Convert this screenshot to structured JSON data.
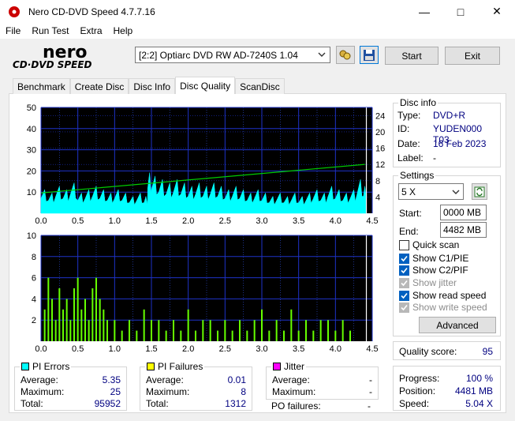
{
  "window": {
    "title": "Nero CD-DVD Speed 4.7.7.16"
  },
  "menu": [
    "File",
    "Run Test",
    "Extra",
    "Help"
  ],
  "toolbar": {
    "drive": "[2:2]   Optiarc DVD RW AD-7240S 1.04",
    "start_label": "Start",
    "exit_label": "Exit"
  },
  "tabs": [
    "Benchmark",
    "Create Disc",
    "Disc Info",
    "Disc Quality",
    "ScanDisc"
  ],
  "active_tab": "Disc Quality",
  "disc_info": {
    "title": "Disc info",
    "type_label": "Type:",
    "type": "DVD+R",
    "id_label": "ID:",
    "id": "YUDEN000 T03",
    "date_label": "Date:",
    "date": "16 Feb 2023",
    "label_label": "Label:",
    "label": "-"
  },
  "settings": {
    "title": "Settings",
    "speed": "5 X",
    "start_label": "Start:",
    "start": "0000 MB",
    "end_label": "End:",
    "end": "4482 MB",
    "quick_scan": "Quick scan",
    "show_c1pie": "Show C1/PIE",
    "show_c2pif": "Show C2/PIF",
    "show_jitter": "Show jitter",
    "show_read_speed": "Show read speed",
    "show_write_speed": "Show write speed",
    "advanced_label": "Advanced"
  },
  "quality": {
    "label": "Quality score:",
    "value": "95"
  },
  "progress": {
    "progress_label": "Progress:",
    "progress": "100 %",
    "position_label": "Position:",
    "position": "4481 MB",
    "speed_label": "Speed:",
    "speed": "5.04 X"
  },
  "pi_errors": {
    "title": "PI Errors",
    "color": "#00ffff",
    "average_label": "Average:",
    "average": "5.35",
    "maximum_label": "Maximum:",
    "maximum": "25",
    "total_label": "Total:",
    "total": "95952"
  },
  "pi_failures": {
    "title": "PI Failures",
    "color": "#ffff00",
    "average_label": "Average:",
    "average": "0.01",
    "maximum_label": "Maximum:",
    "maximum": "8",
    "total_label": "Total:",
    "total": "1312"
  },
  "jitter": {
    "title": "Jitter",
    "color": "#ff00ff",
    "average_label": "Average:",
    "average": "-",
    "maximum_label": "Maximum:",
    "maximum": "-",
    "po_failures_label": "PO failures:",
    "po_failures": "-"
  },
  "chart_data": [
    {
      "type": "area",
      "series": [
        {
          "name": "PI Errors",
          "color": "#00ffff",
          "x": [
            0.0,
            0.1,
            0.2,
            0.3,
            0.4,
            0.5,
            0.6,
            0.7,
            0.8,
            0.9,
            1.0,
            1.1,
            1.2,
            1.3,
            1.4,
            1.45,
            1.5,
            1.6,
            1.7,
            1.8,
            1.9,
            2.0,
            2.1,
            2.2,
            2.3,
            2.4,
            2.5,
            2.6,
            2.7,
            2.8,
            2.9,
            3.0,
            3.1,
            3.2,
            3.3,
            3.4,
            3.5,
            3.6,
            3.7,
            3.8,
            3.9,
            4.0,
            4.1,
            4.2,
            4.3,
            4.38,
            4.42
          ],
          "y": [
            7,
            6,
            8,
            7,
            9,
            6,
            7,
            8,
            7,
            6,
            7,
            6,
            5,
            6,
            5,
            12,
            11,
            10,
            9,
            10,
            9,
            8,
            9,
            8,
            9,
            8,
            7,
            8,
            7,
            6,
            7,
            6,
            5,
            6,
            5,
            6,
            5,
            6,
            7,
            6,
            8,
            7,
            6,
            7,
            10,
            8,
            9
          ]
        },
        {
          "name": "Read speed",
          "color": "#00cc00",
          "x": [
            0.0,
            4.4
          ],
          "y": [
            5,
            12
          ]
        }
      ],
      "xlim": [
        0,
        4.5
      ],
      "ylim": [
        0,
        50
      ],
      "y_ticks": [
        10,
        20,
        30,
        40,
        50
      ],
      "y2_ticks": [
        4,
        8,
        12,
        16,
        20,
        24
      ],
      "x_ticks": [
        "0.0",
        "0.5",
        "1.0",
        "1.5",
        "2.0",
        "2.5",
        "3.0",
        "3.5",
        "4.0",
        "4.5"
      ]
    },
    {
      "type": "bar",
      "series": [
        {
          "name": "PI Failures",
          "color": "#66ff00",
          "x": [
            0.05,
            0.1,
            0.15,
            0.2,
            0.25,
            0.3,
            0.35,
            0.4,
            0.45,
            0.5,
            0.55,
            0.6,
            0.65,
            0.7,
            0.75,
            0.8,
            0.85,
            0.9,
            1.0,
            1.1,
            1.2,
            1.3,
            1.4,
            1.5,
            1.6,
            1.7,
            1.8,
            1.9,
            2.0,
            2.1,
            2.2,
            2.3,
            2.4,
            2.5,
            2.6,
            2.7,
            2.8,
            2.9,
            3.0,
            3.1,
            3.2,
            3.3,
            3.4,
            3.5,
            3.6,
            3.7,
            3.8,
            3.9,
            4.0,
            4.1,
            4.2
          ],
          "y": [
            3,
            6,
            4,
            2,
            5,
            3,
            4,
            2,
            5,
            6,
            3,
            4,
            2,
            5,
            6,
            4,
            3,
            2,
            2,
            1,
            2,
            1,
            3,
            2,
            2,
            1,
            2,
            1,
            3,
            1,
            2,
            2,
            1,
            2,
            1,
            2,
            1,
            2,
            3,
            1,
            2,
            1,
            3,
            1,
            2,
            1,
            2,
            2,
            1,
            2,
            1
          ]
        }
      ],
      "xlim": [
        0,
        4.5
      ],
      "ylim": [
        0,
        10
      ],
      "y_ticks": [
        2,
        4,
        6,
        8,
        10
      ],
      "x_ticks": [
        "0.0",
        "0.5",
        "1.0",
        "1.5",
        "2.0",
        "2.5",
        "3.0",
        "3.5",
        "4.0",
        "4.5"
      ]
    }
  ]
}
